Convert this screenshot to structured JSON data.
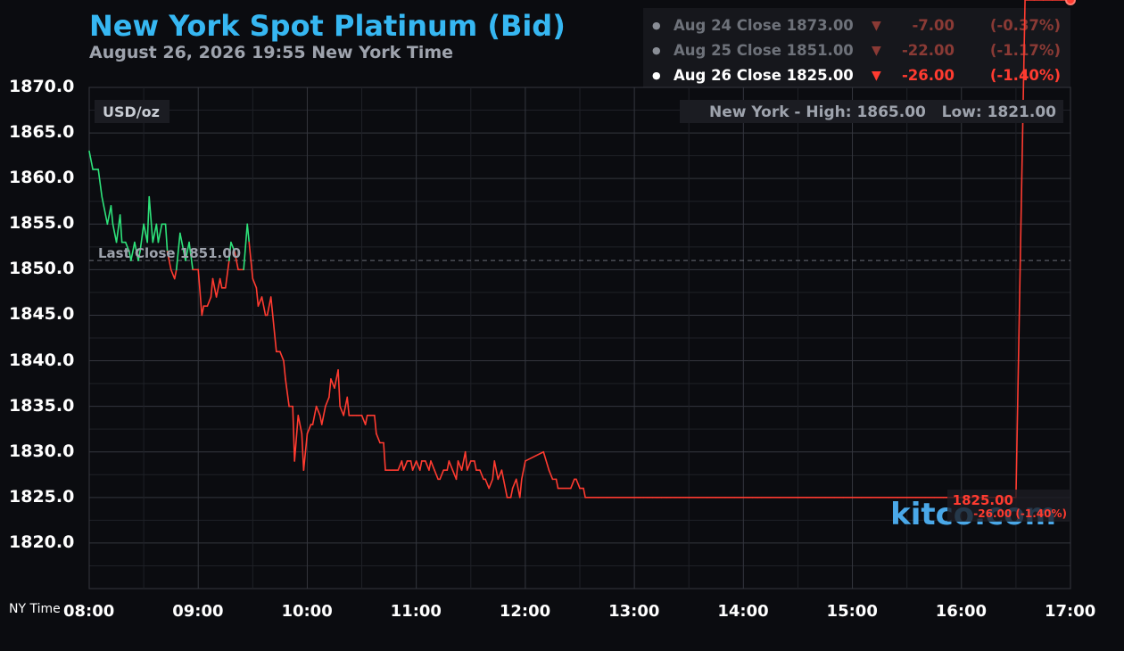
{
  "header": {
    "title": "New York Spot Platinum (Bid)",
    "subtitle": "August 26, 2026 19:55 New York Time"
  },
  "closes": [
    {
      "label": "Aug 24 Close 1873.00",
      "change": "-7.00",
      "pct": "(-0.37%)",
      "active": false
    },
    {
      "label": "Aug 25 Close 1851.00",
      "change": "-22.00",
      "pct": "(-1.17%)",
      "active": false
    },
    {
      "label": "Aug 26 Close 1825.00",
      "change": "-26.00",
      "pct": "(-1.40%)",
      "active": true
    }
  ],
  "colors": {
    "title": "#36b7f2",
    "up": "#2ee27a",
    "down": "#ff3b30",
    "grid": "#2e3038",
    "text": "#ffffff",
    "muted": "#9ea3ad"
  },
  "chart_data": {
    "type": "line",
    "unit_label": "USD/oz",
    "high_low_label": "New York - High: 1865.00   Low: 1821.00",
    "last_close_label": "Last Close 1851.00",
    "last_close": 1851.0,
    "last_price_label": "1825.00",
    "last_change_label": "-26.00 (-1.40%)",
    "watermark": "kitco.com",
    "x_axis_title": "NY Time",
    "ylim": [
      1815,
      1870
    ],
    "yticks": [
      1870,
      1865,
      1860,
      1855,
      1850,
      1845,
      1840,
      1835,
      1830,
      1825,
      1820
    ],
    "ytick_labels": [
      "1870.0",
      "1865.0",
      "1860.0",
      "1855.0",
      "1850.0",
      "1845.0",
      "1840.0",
      "1835.0",
      "1830.0",
      "1825.0",
      "1820.0"
    ],
    "xlim": [
      "08:00",
      "17:00"
    ],
    "xticks": [
      "08:00",
      "09:00",
      "10:00",
      "11:00",
      "12:00",
      "13:00",
      "14:00",
      "15:00",
      "16:00",
      "17:00"
    ],
    "grid": true,
    "x": [
      "08:00",
      "08:02",
      "08:05",
      "08:07",
      "08:08",
      "08:10",
      "08:12",
      "08:13",
      "08:15",
      "08:17",
      "08:18",
      "08:20",
      "08:22",
      "08:23",
      "08:25",
      "08:27",
      "08:28",
      "08:30",
      "08:32",
      "08:33",
      "08:35",
      "08:37",
      "08:38",
      "08:40",
      "08:42",
      "08:43",
      "08:45",
      "08:47",
      "08:48",
      "08:50",
      "08:52",
      "08:53",
      "08:55",
      "08:57",
      "08:58",
      "09:00",
      "09:02",
      "09:03",
      "09:05",
      "09:07",
      "09:08",
      "09:10",
      "09:12",
      "09:13",
      "09:15",
      "09:17",
      "09:18",
      "09:20",
      "09:22",
      "09:23",
      "09:25",
      "09:27",
      "09:28",
      "09:30",
      "09:32",
      "09:33",
      "09:35",
      "09:37",
      "09:38",
      "09:40",
      "09:42",
      "09:43",
      "09:45",
      "09:47",
      "09:48",
      "09:50",
      "09:52",
      "09:53",
      "09:55",
      "09:57",
      "09:58",
      "10:00",
      "10:02",
      "10:03",
      "10:05",
      "10:07",
      "10:08",
      "10:10",
      "10:12",
      "10:13",
      "10:15",
      "10:17",
      "10:18",
      "10:20",
      "10:22",
      "10:23",
      "10:25",
      "10:27",
      "10:28",
      "10:30",
      "10:32",
      "10:33",
      "10:35",
      "10:37",
      "10:38",
      "10:40",
      "10:42",
      "10:43",
      "10:45",
      "10:47",
      "10:48",
      "10:50",
      "10:52",
      "10:53",
      "10:55",
      "10:57",
      "10:58",
      "11:00",
      "11:02",
      "11:03",
      "11:05",
      "11:07",
      "11:08",
      "11:10",
      "11:12",
      "11:13",
      "11:15",
      "11:17",
      "11:18",
      "11:20",
      "11:22",
      "11:23",
      "11:25",
      "11:27",
      "11:28",
      "11:30",
      "11:32",
      "11:33",
      "11:35",
      "11:37",
      "11:38",
      "11:40",
      "11:42",
      "11:43",
      "11:45",
      "11:47",
      "11:48",
      "11:50",
      "11:52",
      "11:53",
      "11:55",
      "11:57",
      "11:58",
      "12:00",
      "12:10",
      "12:13",
      "12:15",
      "12:17",
      "12:18",
      "12:25",
      "12:27",
      "12:28",
      "12:30",
      "12:32",
      "12:33",
      "12:40",
      "12:45",
      "13:00",
      "13:02",
      "13:03",
      "13:05",
      "13:07",
      "13:08",
      "13:10",
      "13:12",
      "13:13",
      "13:15",
      "13:17",
      "13:18",
      "13:20",
      "13:22",
      "13:23",
      "13:25",
      "13:27",
      "13:28",
      "13:30",
      "13:35",
      "13:40",
      "13:45",
      "13:50",
      "13:55",
      "14:00",
      "14:02",
      "14:03",
      "14:05",
      "14:07",
      "14:08",
      "14:10",
      "14:15",
      "14:20",
      "14:25",
      "14:30",
      "14:35",
      "14:40",
      "14:45",
      "14:50",
      "14:55",
      "15:00",
      "15:05",
      "15:10",
      "15:15",
      "15:20",
      "15:25",
      "15:30",
      "15:35",
      "15:40",
      "15:45",
      "15:50",
      "15:55",
      "16:00",
      "16:05",
      "16:10",
      "16:15",
      "16:20",
      "16:25",
      "16:30",
      "16:35",
      "16:40",
      "16:45",
      "16:50",
      "16:55",
      "17:00"
    ],
    "y": [
      1863,
      1861,
      1861,
      1858,
      1857,
      1855,
      1857,
      1855,
      1853,
      1856,
      1853,
      1853,
      1852,
      1851,
      1853,
      1851,
      1852,
      1855,
      1853,
      1858,
      1853,
      1855,
      1853,
      1855,
      1855,
      1852,
      1850,
      1849,
      1850,
      1854,
      1852,
      1851,
      1853,
      1850,
      1850,
      1850,
      1845,
      1846,
      1846,
      1847,
      1849,
      1847,
      1849,
      1848,
      1848,
      1851,
      1853,
      1852,
      1850,
      1850,
      1850,
      1855,
      1853,
      1849,
      1848,
      1846,
      1847,
      1845,
      1845,
      1847,
      1843,
      1841,
      1841,
      1840,
      1838,
      1835,
      1835,
      1829,
      1834,
      1832,
      1828,
      1832,
      1833,
      1833,
      1835,
      1834,
      1833,
      1835,
      1836,
      1838,
      1837,
      1839,
      1835,
      1834,
      1836,
      1834,
      1834,
      1834,
      1834,
      1834,
      1833,
      1834,
      1834,
      1834,
      1832,
      1831,
      1831,
      1828,
      1828,
      1828,
      1828,
      1828,
      1829,
      1828,
      1829,
      1829,
      1828,
      1829,
      1828,
      1829,
      1829,
      1828,
      1829,
      1828,
      1827,
      1827,
      1828,
      1828,
      1829,
      1828,
      1827,
      1829,
      1828,
      1830,
      1828,
      1829,
      1829,
      1828,
      1828,
      1827,
      1827,
      1826,
      1827,
      1829,
      1827,
      1828,
      1827,
      1825,
      1825,
      1826,
      1827,
      1825,
      1827,
      1829,
      1830,
      1828,
      1827,
      1827,
      1826,
      1826,
      1827,
      1827,
      1826,
      1826,
      1825,
      1825,
      1825,
      1825,
      1825,
      1825,
      1825,
      1825,
      1825,
      1825,
      1825,
      1825,
      1825,
      1825,
      1825,
      1825,
      1825,
      1825,
      1825,
      1825,
      1825,
      1825,
      1825,
      1825,
      1825,
      1825,
      1825,
      1825,
      1825,
      1825,
      1825,
      1825,
      1825,
      1825,
      1825,
      1825,
      1825,
      1825,
      1825,
      1825,
      1825,
      1825,
      1825,
      1825,
      1825,
      1825,
      1825,
      1825,
      1825,
      1825,
      1825,
      1825,
      1825,
      1825,
      1825,
      1825,
      1825,
      1825,
      1825,
      1825,
      1825,
      1825
    ]
  }
}
